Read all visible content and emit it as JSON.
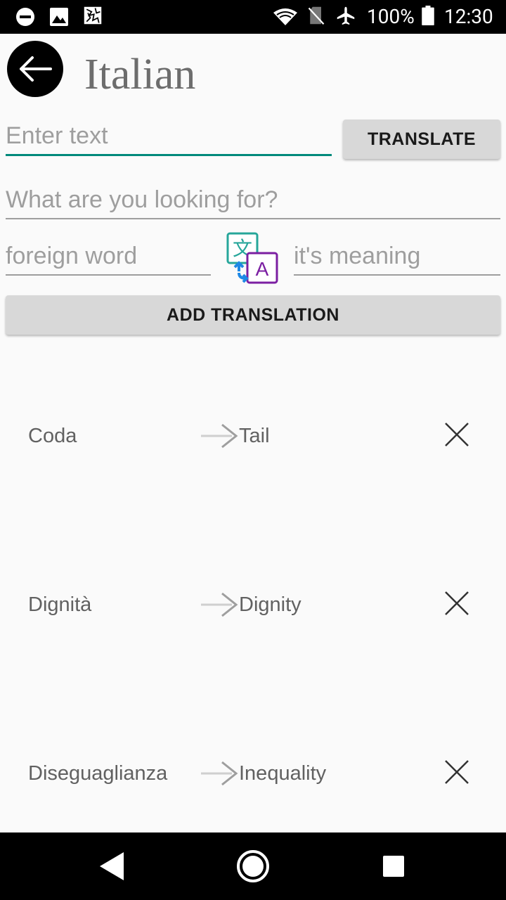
{
  "status_bar": {
    "battery_percent": "100%",
    "time": "12:30"
  },
  "header": {
    "title": "Italian",
    "back_icon": "arrow-left-icon"
  },
  "translate_input": {
    "placeholder": "Enter text",
    "value": ""
  },
  "translate_button_label": "TRANSLATE",
  "search": {
    "placeholder": "What are you looking for?",
    "value": ""
  },
  "add_form": {
    "foreign_placeholder": "foreign word",
    "meaning_placeholder": "it's meaning",
    "swap_icon": "google-translate-icon",
    "button_label": "ADD TRANSLATION"
  },
  "translations": [
    {
      "word": "Coda",
      "meaning": "Tail"
    },
    {
      "word": "Dignità",
      "meaning": "Dignity"
    },
    {
      "word": "Diseguaglianza",
      "meaning": "Inequality"
    }
  ],
  "colors": {
    "accent": "#00897b",
    "button_bg": "#d8d8d8",
    "translate_icon_teal": "#26a69a",
    "translate_icon_purple": "#7b1fa2"
  }
}
